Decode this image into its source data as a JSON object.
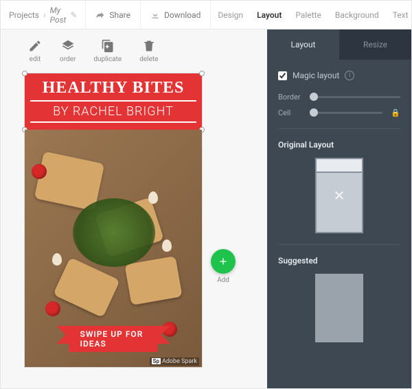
{
  "breadcrumb": {
    "root": "Projects",
    "current": "My Post"
  },
  "topbar": {
    "share": "Share",
    "download": "Download"
  },
  "toptabs": {
    "design": "Design",
    "layout": "Layout",
    "palette": "Palette",
    "background": "Background",
    "text": "Text"
  },
  "tools": {
    "edit": "edit",
    "order": "order",
    "duplicate": "duplicate",
    "delete": "delete"
  },
  "post": {
    "title1": "HEALTHY BITES",
    "title2": "BY RACHEL BRIGHT",
    "ribbon": "SWIPE UP FOR IDEAS",
    "watermark_badge": "Sp",
    "watermark_text": "Adobe Spark"
  },
  "add": {
    "label": "Add"
  },
  "panel": {
    "tabs": {
      "layout": "Layout",
      "resize": "Resize"
    },
    "magic": "Magic layout",
    "border": "Border",
    "cell": "Cell",
    "original": "Original Layout",
    "suggested": "Suggested"
  }
}
